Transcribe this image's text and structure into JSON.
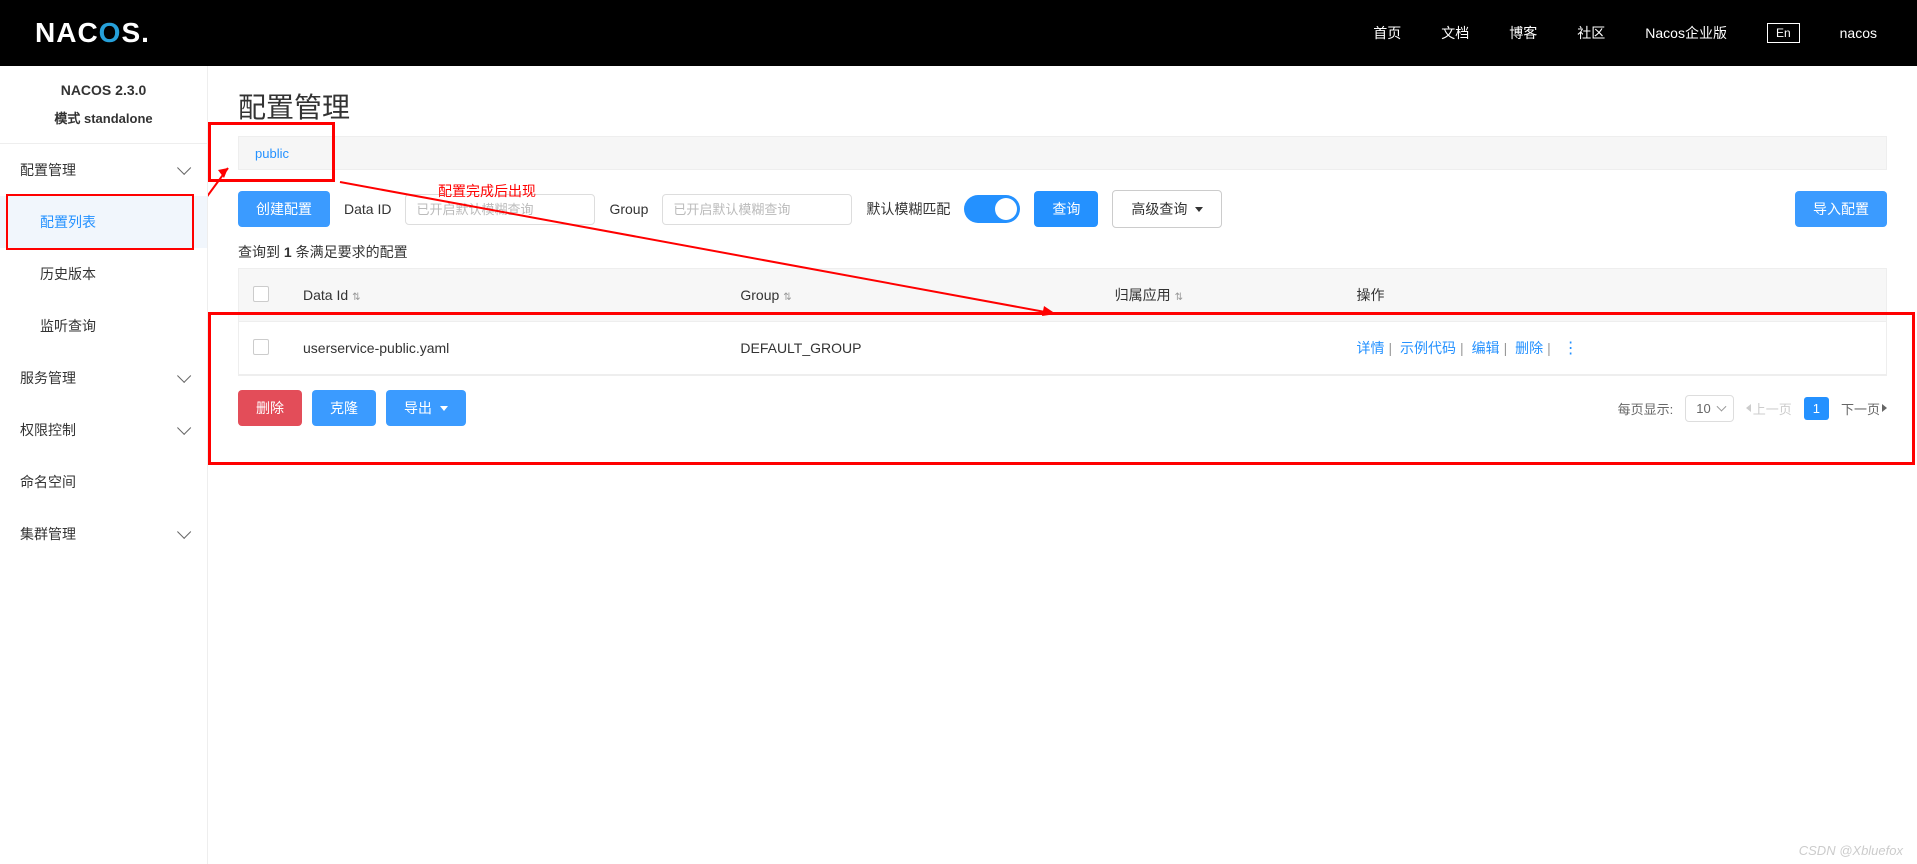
{
  "header": {
    "logo_text": "NACOS.",
    "nav": [
      "首页",
      "文档",
      "博客",
      "社区",
      "Nacos企业版"
    ],
    "lang": "En",
    "user": "nacos"
  },
  "sidebar": {
    "version": "NACOS 2.3.0",
    "mode": "模式  standalone",
    "groups": [
      {
        "label": "配置管理",
        "expandable": true,
        "expanded": true,
        "children": [
          {
            "label": "配置列表",
            "active": true
          },
          {
            "label": "历史版本"
          },
          {
            "label": "监听查询"
          }
        ]
      },
      {
        "label": "服务管理",
        "expandable": true
      },
      {
        "label": "权限控制",
        "expandable": true
      },
      {
        "label": "命名空间",
        "expandable": false
      },
      {
        "label": "集群管理",
        "expandable": true
      }
    ]
  },
  "page": {
    "title": "配置管理",
    "tab": "public",
    "toolbar": {
      "create": "创建配置",
      "dataid_label": "Data ID",
      "dataid_placeholder": "已开启默认模糊查询",
      "group_label": "Group",
      "group_placeholder": "已开启默认模糊查询",
      "fuzzy_label": "默认模糊匹配",
      "query": "查询",
      "advanced": "高级查询",
      "import": "导入配置"
    },
    "result_prefix": "查询到 ",
    "result_count": "1",
    "result_suffix": " 条满足要求的配置",
    "columns": {
      "dataid": "Data Id",
      "group": "Group",
      "app": "归属应用",
      "ops": "操作"
    },
    "rows": [
      {
        "dataid": "userservice-public.yaml",
        "group": "DEFAULT_GROUP",
        "app": ""
      }
    ],
    "ops": {
      "detail": "详情",
      "sample": "示例代码",
      "edit": "编辑",
      "delete": "删除"
    },
    "footer": {
      "delete": "删除",
      "clone": "克隆",
      "export": "导出",
      "per_page": "每页显示:",
      "page_size": "10",
      "prev": "上一页",
      "next": "下一页",
      "current": "1"
    }
  },
  "annotation": {
    "text": "配置完成后出现"
  },
  "watermark": "CSDN @Xbluefox"
}
